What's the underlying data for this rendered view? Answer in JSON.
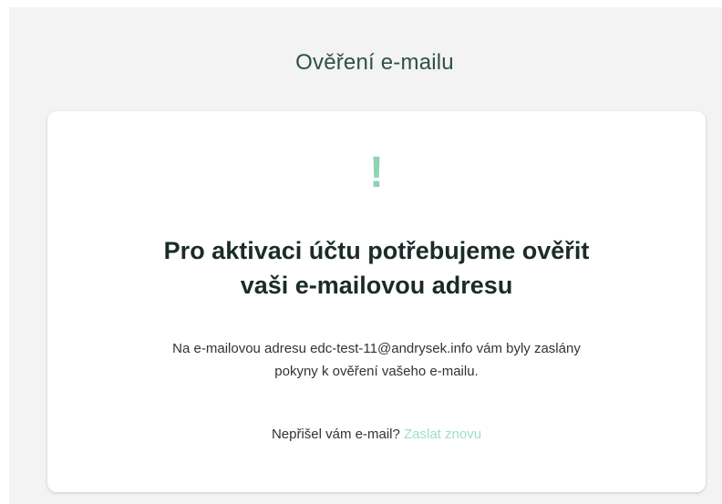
{
  "page": {
    "title": "Ověření e-mailu"
  },
  "card": {
    "icon": "exclamation-icon",
    "icon_glyph": "!",
    "icon_color": "#8fd3b5",
    "heading_line1": "Pro aktivaci účtu potřebujeme ověřit",
    "heading_line2": "vaši e-mailovou adresu",
    "message_line1": "Na e-mailovou adresu edc-test-11@andrysek.info vám byly zaslány",
    "message_line2": "pokyny k ověření vašeho e-mailu.",
    "resend_prompt": "Nepřišel vám e-mail? ",
    "resend_link": "Zaslat znovu",
    "link_color": "#9fe0c0"
  }
}
